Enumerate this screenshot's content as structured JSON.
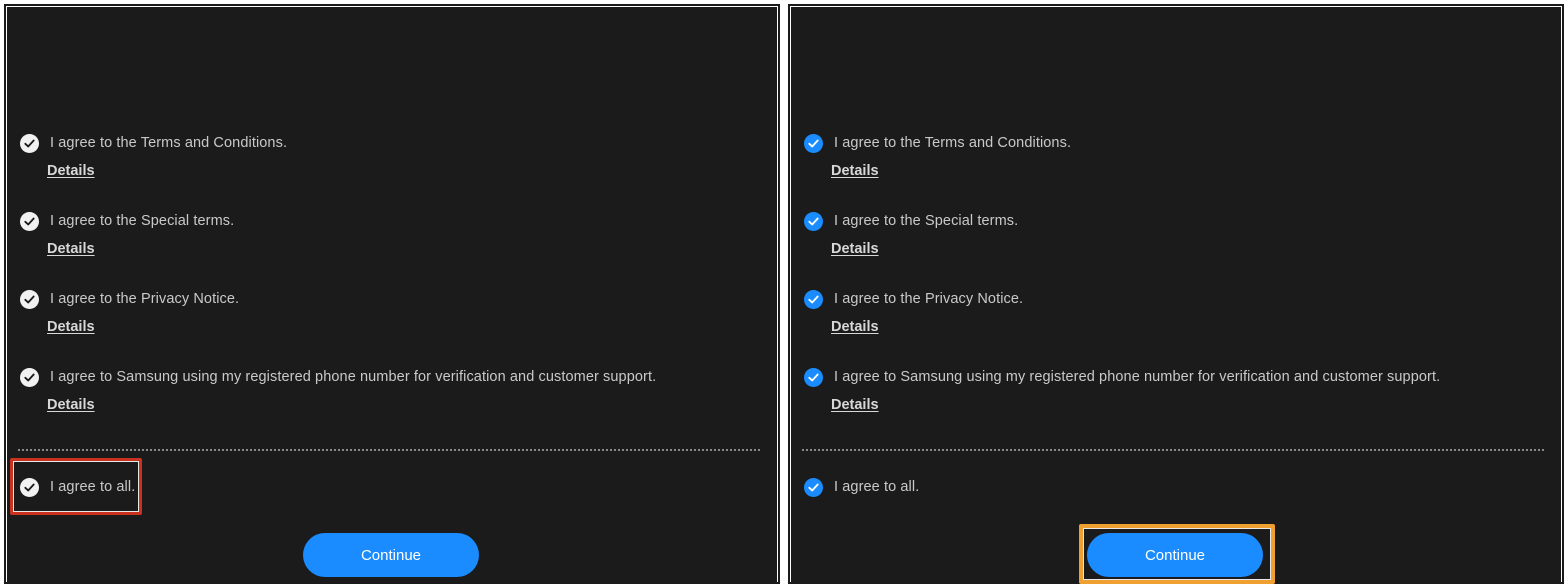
{
  "panels": [
    {
      "id": "left",
      "check_style": "white",
      "agreements": [
        {
          "label": "I agree to the Terms and Conditions.",
          "details": "Details",
          "checked": true
        },
        {
          "label": "I agree to the Special terms.",
          "details": "Details",
          "checked": true
        },
        {
          "label": "I agree to the Privacy Notice.",
          "details": "Details",
          "checked": true
        },
        {
          "label": "I agree to Samsung using my registered phone number for verification and customer support.",
          "details": "Details",
          "checked": true
        }
      ],
      "agree_all": {
        "label": "I agree to all.",
        "checked": true
      },
      "continue_label": "Continue",
      "highlight": "agree-all",
      "highlight_color": "#c8321e"
    },
    {
      "id": "right",
      "check_style": "blue",
      "agreements": [
        {
          "label": "I agree to the Terms and Conditions.",
          "details": "Details",
          "checked": true
        },
        {
          "label": "I agree to the Special terms.",
          "details": "Details",
          "checked": true
        },
        {
          "label": "I agree to the Privacy Notice.",
          "details": "Details",
          "checked": true
        },
        {
          "label": "I agree to Samsung using my registered phone number for verification and customer support.",
          "details": "Details",
          "checked": true
        }
      ],
      "agree_all": {
        "label": "I agree to all.",
        "checked": true
      },
      "continue_label": "Continue",
      "highlight": "continue-button",
      "highlight_color": "#f0a030"
    }
  ],
  "colors": {
    "background": "#1b1b1b",
    "accent": "#1a8cff",
    "text": "#c9c9c9"
  },
  "icons": {
    "check": "checkmark-circle-icon"
  }
}
